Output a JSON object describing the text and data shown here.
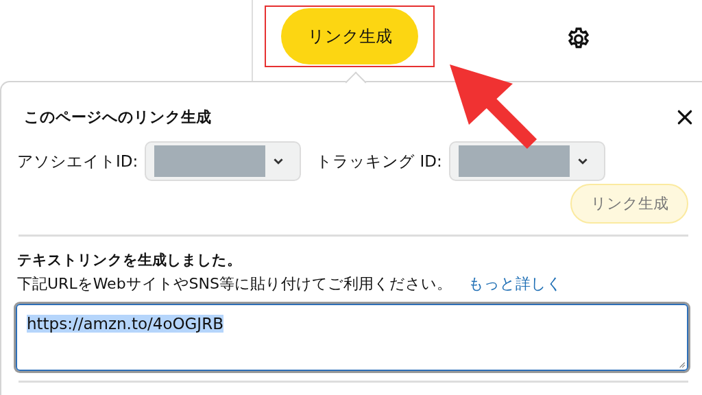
{
  "toolbar": {
    "generate_button": {
      "label": "リンク生成",
      "highlighted": true
    }
  },
  "popover": {
    "title": "このページへのリンク生成",
    "selects": [
      {
        "label": "アソシエイトID:",
        "redacted": true
      },
      {
        "label": "トラッキング ID:",
        "redacted": true
      }
    ],
    "generate_button": {
      "label": "リンク生成",
      "disabled": true
    },
    "result_heading": "テキストリンクを生成しました。",
    "result_text": "下記URLをWebサイトやSNS等に貼り付けてご利用ください。",
    "more_link": "もっと詳しく",
    "url_field": {
      "value": "https://amzn.to/4oOGJRB",
      "selected": true
    }
  },
  "annotation": {
    "arrow": true
  }
}
